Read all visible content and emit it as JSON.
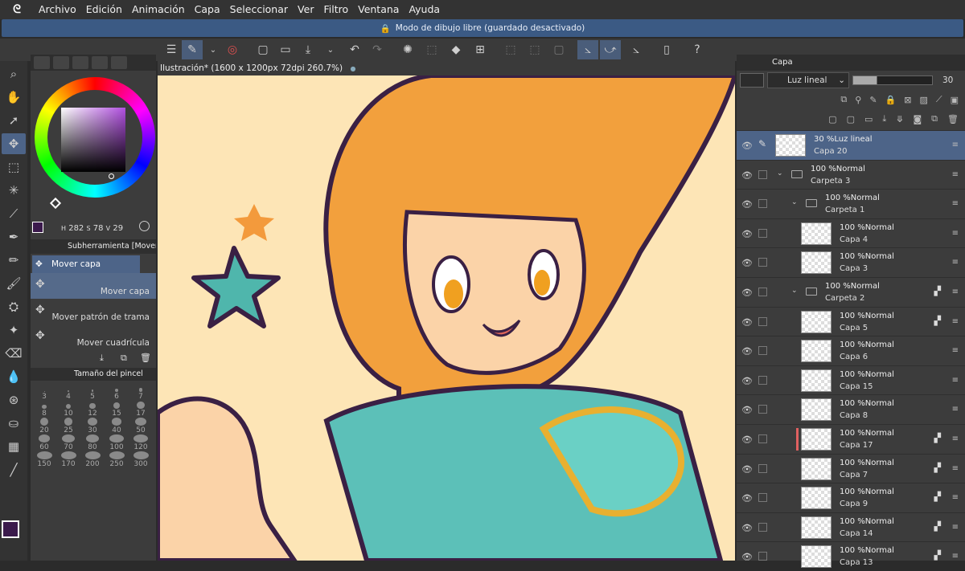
{
  "menu": [
    "Archivo",
    "Edición",
    "Animación",
    "Capa",
    "Seleccionar",
    "Ver",
    "Filtro",
    "Ventana",
    "Ayuda"
  ],
  "status": "Modo de dibujo libre (guardado desactivado)",
  "canvas_title": "Ilustración* (1600 x 1200px 72dpi 260.7%)",
  "color": {
    "h": "282",
    "s": "78",
    "v": "29",
    "main": "#3b1a4c",
    "sub": "#ffffff"
  },
  "subtool": {
    "header": "Subherramienta [Mover ca",
    "group": "Mover capa",
    "items": [
      "Mover capa",
      "Mover patrón de trama",
      "Mover cuadrícula"
    ]
  },
  "brush": {
    "header": "Tamaño del pincel",
    "sizes": [
      "3",
      "4",
      "5",
      "6",
      "7",
      "8",
      "10",
      "12",
      "15",
      "17",
      "20",
      "25",
      "30",
      "40",
      "50",
      "60",
      "70",
      "80",
      "100",
      "120",
      "150",
      "170",
      "200",
      "250",
      "300"
    ]
  },
  "layer_panel": {
    "tab": "Capa",
    "blend_mode": "Luz lineal",
    "opacity": "30",
    "opacity_fraction": 0.3,
    "layers": [
      {
        "mode": "30 %Luz lineal",
        "name": "Capa 20",
        "type": "layer",
        "selected": true
      },
      {
        "mode": "100 %Normal",
        "name": "Carpeta 3",
        "type": "folder"
      },
      {
        "mode": "100 %Normal",
        "name": "Carpeta 1",
        "type": "folder"
      },
      {
        "mode": "100 %Normal",
        "name": "Capa 4",
        "type": "layer"
      },
      {
        "mode": "100 %Normal",
        "name": "Capa 3",
        "type": "layer"
      },
      {
        "mode": "100 %Normal",
        "name": "Carpeta 2",
        "type": "folder"
      },
      {
        "mode": "100 %Normal",
        "name": "Capa 5",
        "type": "layer"
      },
      {
        "mode": "100 %Normal",
        "name": "Capa 6",
        "type": "layer"
      },
      {
        "mode": "100 %Normal",
        "name": "Capa 15",
        "type": "layer"
      },
      {
        "mode": "100 %Normal",
        "name": "Capa 8",
        "type": "layer"
      },
      {
        "mode": "100 %Normal",
        "name": "Capa 17",
        "type": "layer"
      },
      {
        "mode": "100 %Normal",
        "name": "Capa 7",
        "type": "layer"
      },
      {
        "mode": "100 %Normal",
        "name": "Capa 9",
        "type": "layer"
      },
      {
        "mode": "100 %Normal",
        "name": "Capa 14",
        "type": "layer"
      },
      {
        "mode": "100 %Normal",
        "name": "Capa 13",
        "type": "layer"
      }
    ]
  }
}
